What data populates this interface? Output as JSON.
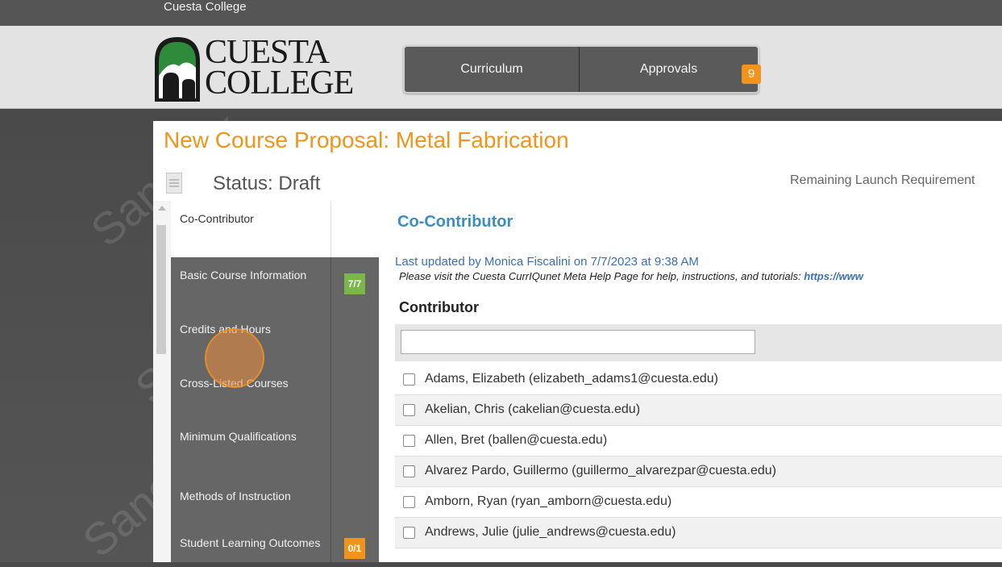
{
  "topbar": {
    "college_link": "Cuesta College"
  },
  "logo": {
    "line1": "CUESTA",
    "line2": "COLLEGE"
  },
  "nav": {
    "curriculum": "Curriculum",
    "approvals": "Approvals",
    "approvals_badge": "9"
  },
  "watermark": "Sandbox",
  "page": {
    "title": "New Course Proposal: Metal Fabrication",
    "status": "Status: Draft",
    "remaining": "Remaining Launch Requirement"
  },
  "sidebar": {
    "items": [
      {
        "label": "Co-Contributor",
        "badge": ""
      },
      {
        "label": "Basic Course Information",
        "badge": "7/7"
      },
      {
        "label": "Credits and Hours",
        "badge": ""
      },
      {
        "label": "Cross-Listed Courses",
        "badge": ""
      },
      {
        "label": "Minimum Qualifications",
        "badge": ""
      },
      {
        "label": "Methods of Instruction",
        "badge": ""
      },
      {
        "label": "Student Learning Outcomes",
        "badge": "0/1"
      }
    ]
  },
  "content": {
    "section_title": "Co-Contributor",
    "last_updated": "Last updated by Monica Fiscalini on 7/7/2023 at 9:38 AM",
    "help_text": "Please visit the Cuesta CurrIQunet Meta Help Page for help, instructions, and tutorials: ",
    "help_link": "https://www",
    "contributor_heading": "Contributor",
    "search_value": "",
    "contributors": [
      "Adams, Elizabeth (elizabeth_adams1@cuesta.edu)",
      "Akelian, Chris (cakelian@cuesta.edu)",
      "Allen, Bret (ballen@cuesta.edu)",
      "Alvarez Pardo, Guillermo (guillermo_alvarezpar@cuesta.edu)",
      "Amborn, Ryan (ryan_amborn@cuesta.edu)",
      "Andrews, Julie (julie_andrews@cuesta.edu)"
    ]
  },
  "colors": {
    "accent_orange": "#f0941b",
    "badge_green": "#7ab648",
    "link_blue": "#3b8ec2"
  }
}
